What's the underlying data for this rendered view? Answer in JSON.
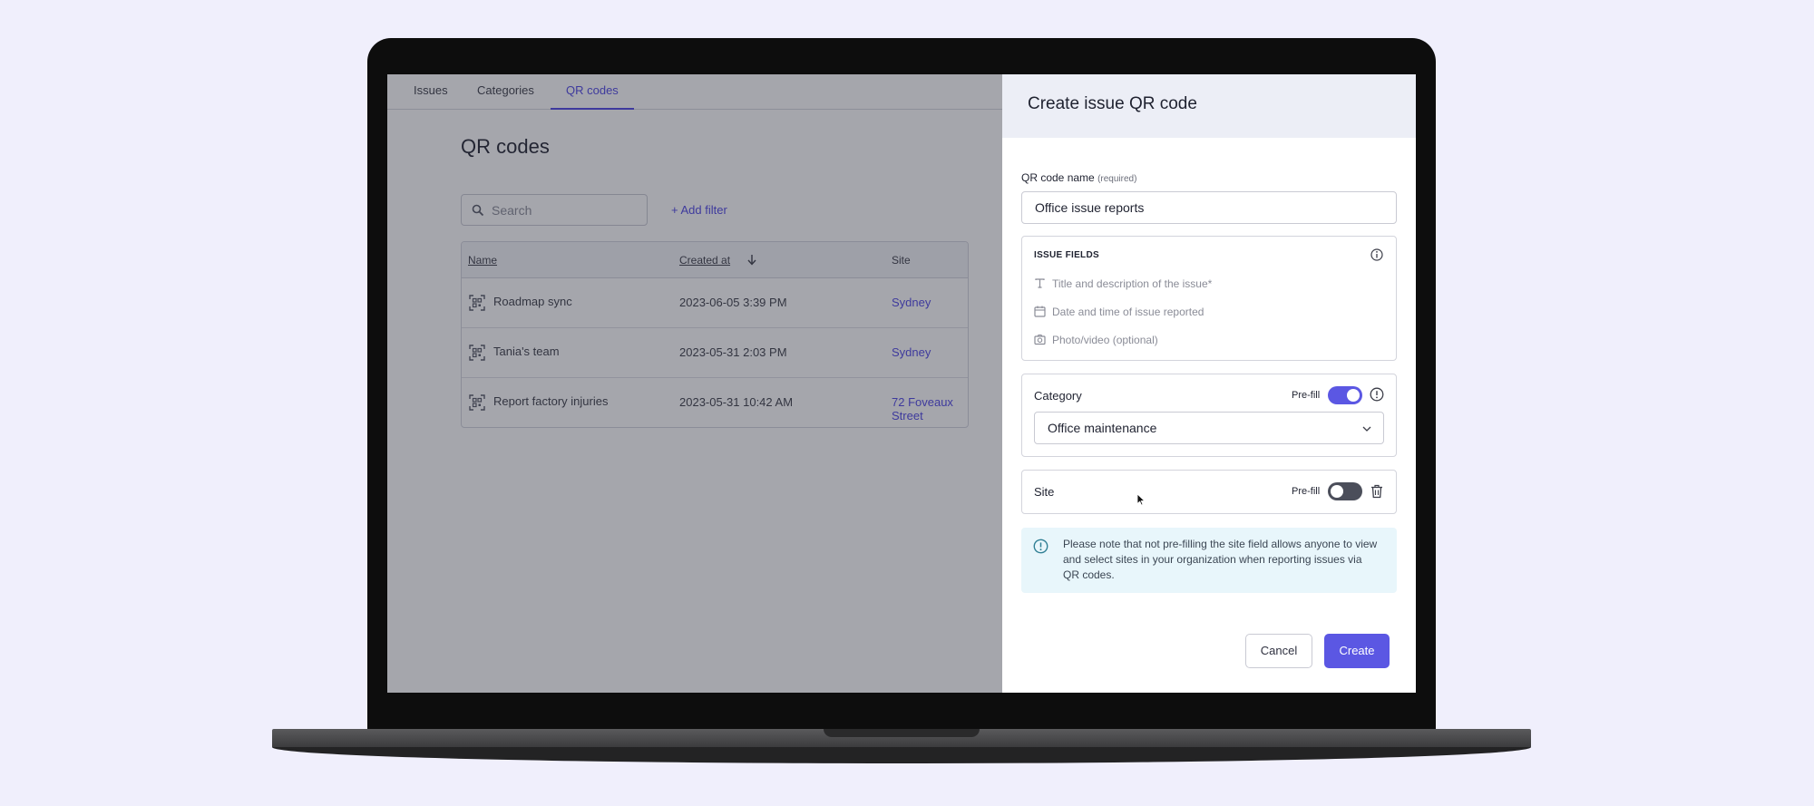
{
  "tabs": [
    {
      "label": "Issues",
      "active": false
    },
    {
      "label": "Categories",
      "active": false
    },
    {
      "label": "QR codes",
      "active": true
    }
  ],
  "page": {
    "title": "QR codes",
    "search_placeholder": "Search",
    "add_filter_label": "+ Add filter"
  },
  "table": {
    "headers": {
      "name": "Name",
      "created_at": "Created at",
      "site": "Site"
    },
    "rows": [
      {
        "name": "Roadmap sync",
        "created_at": "2023-06-05 3:39 PM",
        "site": "Sydney"
      },
      {
        "name": "Tania's team",
        "created_at": "2023-05-31 2:03 PM",
        "site": "Sydney"
      },
      {
        "name": "Report factory injuries",
        "created_at": "2023-05-31 10:42 AM",
        "site": "72 Foveaux Street"
      }
    ]
  },
  "drawer": {
    "title": "Create issue QR code",
    "name_label": "QR code name",
    "name_required": "(required)",
    "name_value": "Office issue reports",
    "issue_fields": {
      "title": "ISSUE FIELDS",
      "items": [
        {
          "icon": "text-icon",
          "label": "Title and description of the issue*"
        },
        {
          "icon": "calendar-icon",
          "label": "Date and time of issue reported"
        },
        {
          "icon": "camera-icon",
          "label": "Photo/video (optional)"
        }
      ]
    },
    "category": {
      "label": "Category",
      "prefill_label": "Pre-fill",
      "prefill_on": true,
      "selected": "Office maintenance"
    },
    "site": {
      "label": "Site",
      "prefill_label": "Pre-fill",
      "prefill_on": false
    },
    "notice": "Please note that not pre-filling the site field allows anyone to view and select sites in your organization when reporting issues via QR codes.",
    "cancel_label": "Cancel",
    "create_label": "Create"
  },
  "colors": {
    "accent": "#5b57e3",
    "link": "#4f46e5",
    "notice_bg": "#e8f6fb",
    "background": "#f0effc"
  }
}
